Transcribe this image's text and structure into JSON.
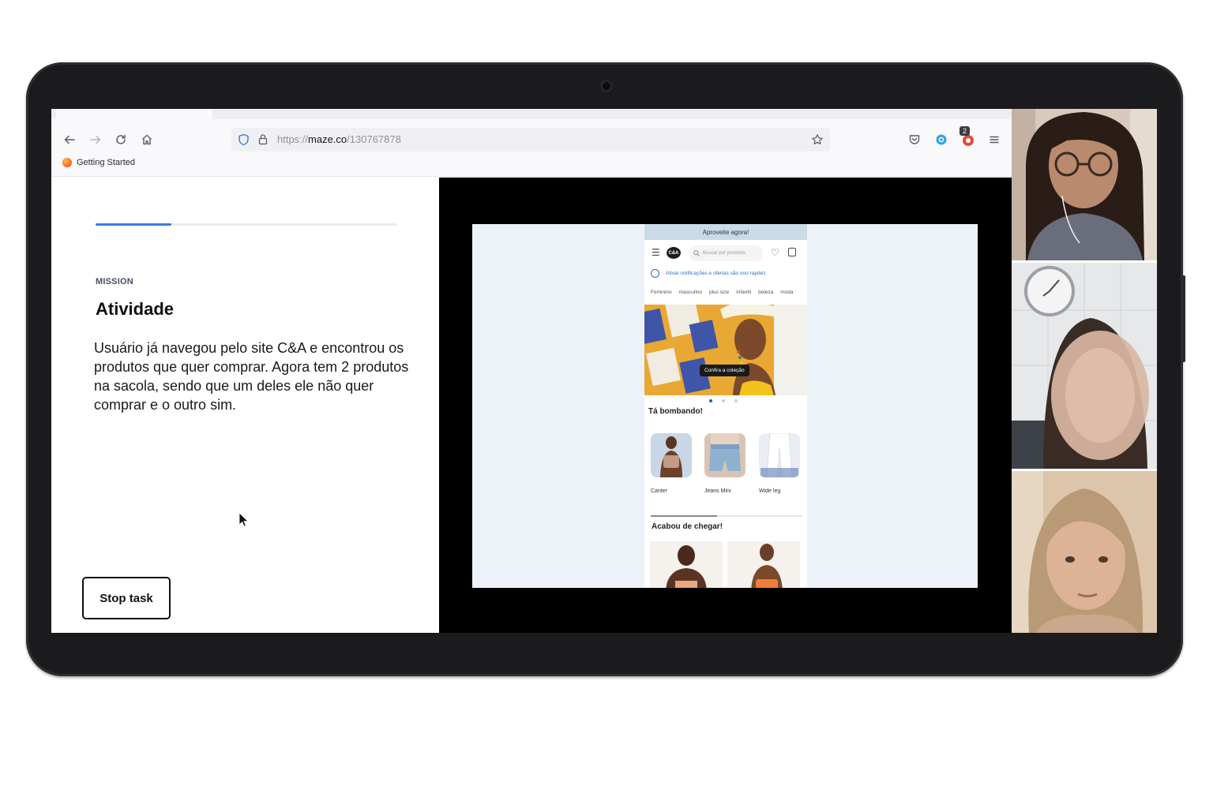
{
  "browser": {
    "url_scheme": "https://",
    "url_host": "maze.co",
    "url_path": "/130767878",
    "bookmark_label": "Getting Started",
    "extension_badge": "2"
  },
  "mission": {
    "progress_percent": 25,
    "label": "MISSION",
    "title": "Atividade",
    "description": "Usuário já navegou pelo site C&A e encontrou os produtos que quer comprar. Agora tem 2 produtos na sacola, sendo que um deles ele não quer comprar e o outro sim.",
    "stop_button": "Stop task"
  },
  "prototype": {
    "promo_bar": "Aproveite agora!",
    "logo": "C&A",
    "search_placeholder": "Buscar por produtos",
    "notification": "Ativar notificações e ofertas são ooo rapdez",
    "categories": [
      "Feminino",
      "masculino",
      "plus size",
      "infantil",
      "beleza",
      "moda"
    ],
    "hero_cta": "Confira a coleção",
    "section_trending": "Tá bombando!",
    "products": [
      {
        "label": "Canter"
      },
      {
        "label": "Jeans Mini"
      },
      {
        "label": "Wide leg"
      }
    ],
    "section_new": "Acabou de chegar!"
  },
  "colors": {
    "accent": "#3b7ddd",
    "device_frame": "#1b1b1d"
  }
}
